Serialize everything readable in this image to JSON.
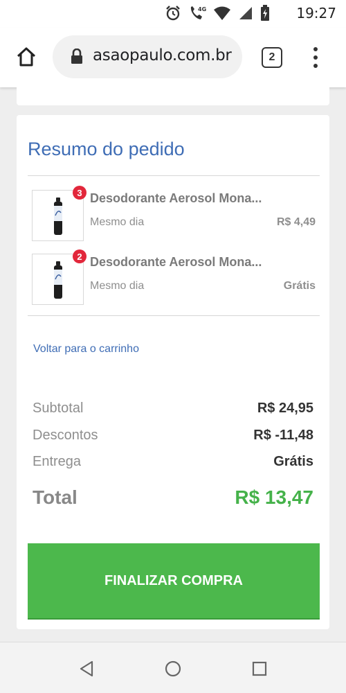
{
  "status_bar": {
    "time": "19:27",
    "icons": [
      "alarm-icon",
      "call-4g-icon",
      "wifi-icon",
      "signal-icon",
      "battery-icon"
    ],
    "network_label": "4G"
  },
  "browser": {
    "url": "asaopaulo.com.br",
    "tab_count": "2",
    "icons": [
      "home-icon",
      "lock-icon",
      "tabs-icon",
      "overflow-menu-icon"
    ]
  },
  "summary": {
    "title": "Resumo do pedido",
    "items": [
      {
        "badge": "3",
        "name": "Desodorante Aerosol Mona...",
        "delivery": "Mesmo dia",
        "price": "R$ 4,49"
      },
      {
        "badge": "2",
        "name": "Desodorante Aerosol Mona...",
        "delivery": "Mesmo dia",
        "price": "Grátis"
      }
    ],
    "back_link": "Voltar para o carrinho",
    "subtotal_label": "Subtotal",
    "subtotal_value": "R$ 24,95",
    "discount_label": "Descontos",
    "discount_value": "R$ -11,48",
    "shipping_label": "Entrega",
    "shipping_value": "Grátis",
    "total_label": "Total",
    "total_value": "R$ 13,47",
    "checkout_label": "FINALIZAR COMPRA"
  },
  "colors": {
    "link_blue": "#3f6db5",
    "total_green": "#45b24a",
    "button_green": "#4cb84c",
    "badge_red": "#e2273b"
  },
  "nav_bar": {
    "icons": [
      "back-triangle-icon",
      "home-circle-icon",
      "recents-square-icon"
    ]
  }
}
